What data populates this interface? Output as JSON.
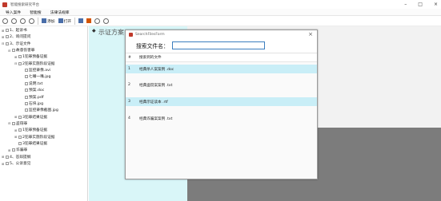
{
  "window": {
    "title": "智能搜索研究平台"
  },
  "menubar": {
    "items": [
      "导入案件",
      "智能搜",
      "法律法规库"
    ]
  },
  "toolbar": {
    "add_label": "添加",
    "open_label": "打开"
  },
  "tree": {
    "nodes": [
      {
        "label": "1、起诉书",
        "indent": 0,
        "exp": "+"
      },
      {
        "label": "2、询问提问",
        "indent": 0,
        "exp": "+"
      },
      {
        "label": "3、示证文件",
        "indent": 0,
        "exp": "−"
      },
      {
        "label": "故意伤害罪",
        "indent": 1,
        "exp": "−"
      },
      {
        "label": "1犯罪预备证据",
        "indent": 2,
        "exp": "+"
      },
      {
        "label": "2犯罪实施阶段证据",
        "indent": 2,
        "exp": "−"
      },
      {
        "label": "监控录像.avi",
        "indent": 3,
        "exp": ""
      },
      {
        "label": "七嘴一嘴.jpg",
        "indent": 3,
        "exp": ""
      },
      {
        "label": "说明.txt",
        "indent": 3,
        "exp": ""
      },
      {
        "label": "预案.doc",
        "indent": 3,
        "exp": ""
      },
      {
        "label": "预案.pdf",
        "indent": 3,
        "exp": ""
      },
      {
        "label": "石块.jpg",
        "indent": 3,
        "exp": ""
      },
      {
        "label": "监控录像截图.jpg",
        "indent": 3,
        "exp": ""
      },
      {
        "label": "3犯罪结果证据",
        "indent": 2,
        "exp": "+"
      },
      {
        "label": "盗窃罪",
        "indent": 1,
        "exp": "−"
      },
      {
        "label": "1犯罪预备证据",
        "indent": 2,
        "exp": "+"
      },
      {
        "label": "2犯罪实施阶段证据",
        "indent": 2,
        "exp": "+"
      },
      {
        "label": "3犯罪结果证据",
        "indent": 2,
        "exp": ""
      },
      {
        "label": "诈骗罪",
        "indent": 1,
        "exp": "+"
      },
      {
        "label": "4、答辩提纲",
        "indent": 0,
        "exp": "+"
      },
      {
        "label": "5、公诉意见",
        "indent": 0,
        "exp": "+"
      }
    ]
  },
  "editor": {
    "caption": "示证方案"
  },
  "dialog": {
    "title": "SearchFilesForm",
    "search_label": "搜索文件名：",
    "search_value": "",
    "columns": {
      "index": "#",
      "name": "搜索到的文件"
    },
    "rows": [
      {
        "index": "1",
        "name": "经典杀人案案例 .doc",
        "highlighted": true
      },
      {
        "index": "2",
        "name": "经典盗窃案案例 .txt",
        "highlighted": false
      },
      {
        "index": "3",
        "name": "经典示证读本 .rtf",
        "highlighted": true
      },
      {
        "index": "4",
        "name": "经典诈骗案案例 .txt",
        "highlighted": false
      }
    ]
  }
}
